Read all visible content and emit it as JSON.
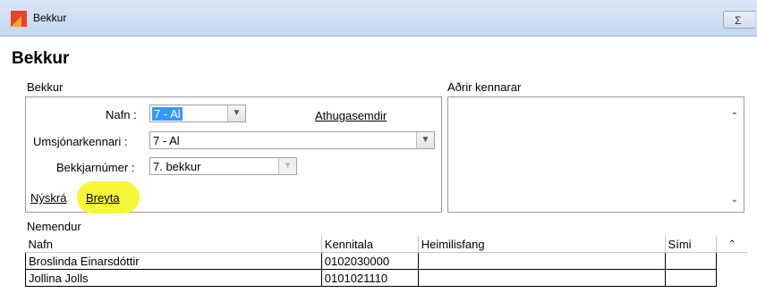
{
  "window": {
    "title": "Bekkur",
    "close_glyph": "Σ"
  },
  "form": {
    "title": "Bekkur"
  },
  "bekkur_group": {
    "label": "Bekkur",
    "nafn_label": "Nafn :",
    "nafn_value": "7 - Al",
    "athugasemdir_link": "Athugasemdir",
    "umsjon_label": "Umsjónarkennari :",
    "umsjon_value": "7 - Al",
    "bekkjarnumer_label": "Bekkjarnúmer :",
    "bekkjarnumer_value": "7. bekkur",
    "nyskra_link": "Nýskrá",
    "breyta_link": "Breyta"
  },
  "adrir_group": {
    "label": "Aðrir kennarar"
  },
  "nemendur": {
    "label": "Nemendur",
    "columns": [
      "Nafn",
      "Kennitala",
      "Heimilisfang",
      "Sími"
    ],
    "rows": [
      [
        "Broslinda Einarsdóttir",
        "0102030000",
        "",
        ""
      ],
      [
        "Jollina Jolls",
        "0101021110",
        "",
        ""
      ]
    ]
  },
  "colors": {
    "highlight": "#f7f73a",
    "selection": "#3399ff",
    "icon_red": "#e8412c",
    "icon_orange": "#f5a623"
  }
}
